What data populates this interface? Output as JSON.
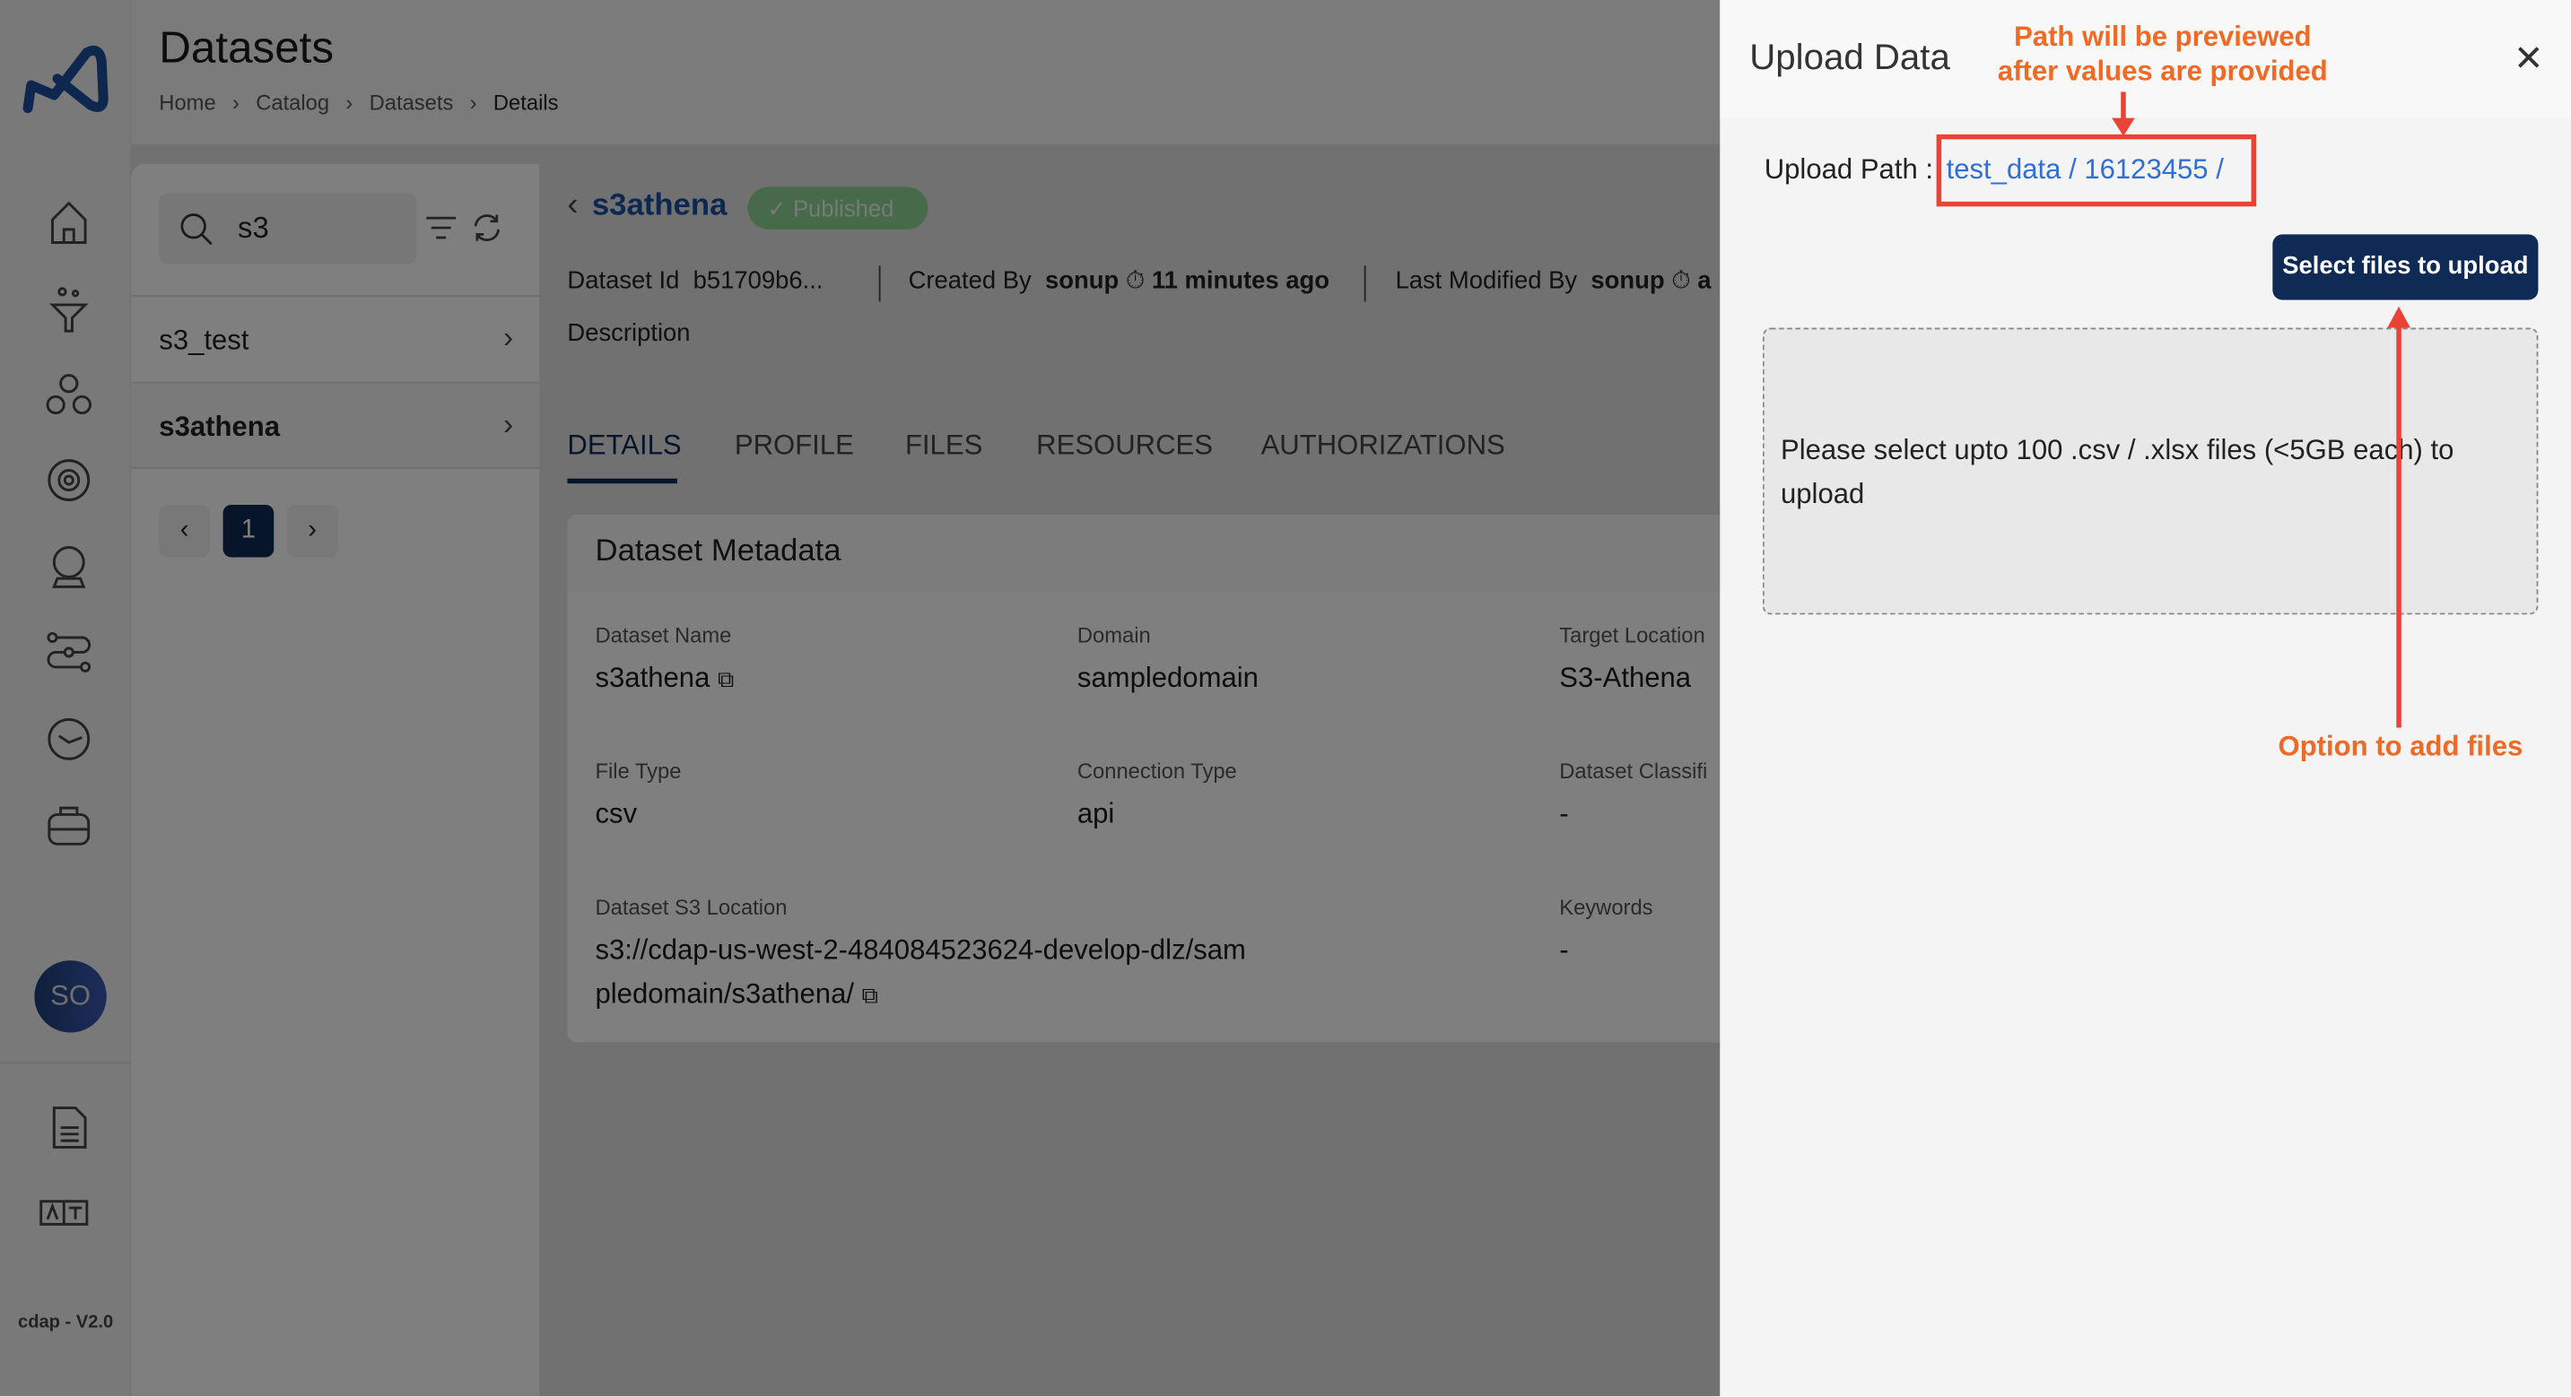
{
  "app": {
    "version": "cdap - V2.0",
    "avatar_initials": "SO",
    "logo": "cdap-logo",
    "nav_icons": [
      "home-icon",
      "data-ingestion-icon",
      "hierarchy-icon",
      "settings-gear-icon",
      "crystal-ball-icon",
      "pipeline-icon",
      "clock-icon",
      "briefcase-icon",
      "document-icon",
      "translate-icon"
    ]
  },
  "header": {
    "title": "Datasets",
    "breadcrumbs": [
      "Home",
      "Catalog",
      "Datasets",
      "Details"
    ]
  },
  "list": {
    "search_value": "s3",
    "items": [
      {
        "label": "s3_test",
        "selected": false
      },
      {
        "label": "s3athena",
        "selected": true
      }
    ],
    "page": "1"
  },
  "detail": {
    "name": "s3athena",
    "status": "Published",
    "status_color": "#5bb462",
    "dataset_id_label": "Dataset Id",
    "dataset_id": "b51709b6...",
    "created_by_label": "Created By",
    "created_by": "sonup",
    "created_ago": "11 minutes ago",
    "modified_by_label": "Last Modified By",
    "modified_by": "sonup",
    "modified_ago": "a",
    "description_label": "Description",
    "tabs": [
      "DETAILS",
      "PROFILE",
      "FILES",
      "RESOURCES",
      "AUTHORIZATIONS"
    ],
    "active_tab": "DETAILS"
  },
  "metadata": {
    "title": "Dataset Metadata",
    "fields": [
      {
        "label": "Dataset Name",
        "value": "s3athena"
      },
      {
        "label": "Domain",
        "value": "sampledomain"
      },
      {
        "label": "Target Location",
        "value": "S3-Athena"
      },
      {
        "label": "File Type",
        "value": "csv"
      },
      {
        "label": "Connection Type",
        "value": "api"
      },
      {
        "label": "Dataset Classifi",
        "value": "-"
      },
      {
        "label": "Dataset S3 Location",
        "value": "s3://cdap-us-west-2-484084523624-develop-dlz/sampledomain/s3athena/"
      },
      {
        "label": "Keywords",
        "value": "-"
      }
    ]
  },
  "drawer": {
    "title": "Upload Data",
    "upload_path_label": "Upload Path :",
    "upload_path": "test_data / 16123455 /",
    "select_button": "Select files to upload",
    "drop_text": "Please select upto 100 .csv / .xlsx files (<5GB each) to upload",
    "brand_color": "#0f2a54"
  },
  "annotations": {
    "path_note_1": "Path will be previewed",
    "path_note_2": "after values are provided",
    "files_note": "Option to add files",
    "color": "#f06a25"
  }
}
